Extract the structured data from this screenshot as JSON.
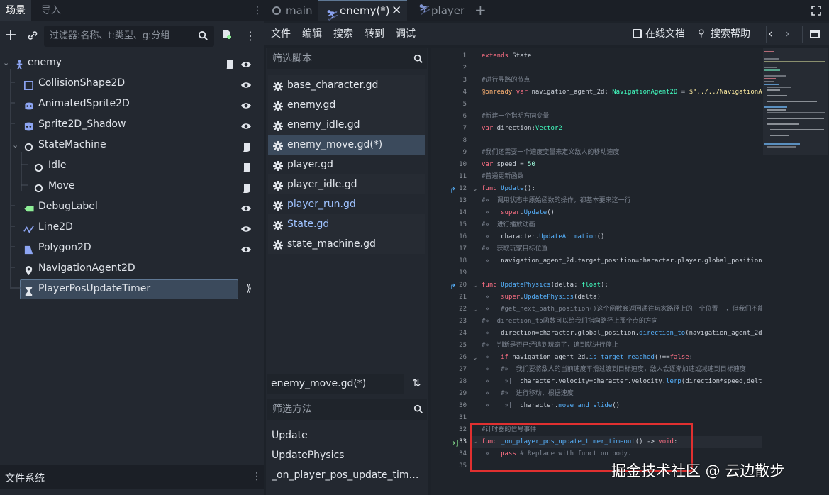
{
  "left_dock": {
    "tabs": [
      "场景",
      "导入"
    ],
    "filter_placeholder": "过滤器:名称、t:类型、g:分组",
    "filesystem_tab": "文件系统"
  },
  "scene_tree": [
    {
      "name": "enemy",
      "icon": "character-icon",
      "depth": 0,
      "script": true,
      "visible": true,
      "collapsible": true
    },
    {
      "name": "CollisionShape2D",
      "icon": "collision-shape-icon",
      "depth": 1,
      "visible": true
    },
    {
      "name": "AnimatedSprite2D",
      "icon": "animated-sprite-icon",
      "depth": 1,
      "visible": true
    },
    {
      "name": "Sprite2D_Shadow",
      "icon": "sprite-icon",
      "depth": 1,
      "visible": true
    },
    {
      "name": "StateMachine",
      "icon": "node-icon",
      "depth": 1,
      "script": true,
      "collapsible": true
    },
    {
      "name": "Idle",
      "icon": "node-icon",
      "depth": 2,
      "script": true
    },
    {
      "name": "Move",
      "icon": "node-icon",
      "depth": 2,
      "script": true
    },
    {
      "name": "DebugLabel",
      "icon": "label-icon",
      "depth": 1,
      "visible": true
    },
    {
      "name": "Line2D",
      "icon": "line-icon",
      "depth": 1,
      "visible": true
    },
    {
      "name": "Polygon2D",
      "icon": "polygon-icon",
      "depth": 1,
      "visible": true
    },
    {
      "name": "NavigationAgent2D",
      "icon": "navigation-agent-icon",
      "depth": 1
    },
    {
      "name": "PlayerPosUpdateTimer",
      "icon": "timer-icon",
      "depth": 1,
      "signal": true,
      "selected": true
    }
  ],
  "editor_tabs": [
    {
      "label": "main",
      "icon": "node-icon"
    },
    {
      "label": "enemy(*)",
      "icon": "character-icon",
      "active": true
    },
    {
      "label": "player",
      "icon": "character-icon"
    }
  ],
  "menu": [
    "文件",
    "编辑",
    "搜索",
    "转到",
    "调试"
  ],
  "menu_right": {
    "online_docs": "在线文档",
    "search_help": "搜索帮助"
  },
  "scripts": {
    "filter_placeholder": "筛选脚本",
    "items": [
      {
        "name": "base_character.gd"
      },
      {
        "name": "enemy.gd"
      },
      {
        "name": "enemy_idle.gd"
      },
      {
        "name": "enemy_move.gd(*)",
        "selected": true
      },
      {
        "name": "player.gd"
      },
      {
        "name": "player_idle.gd"
      },
      {
        "name": "player_run.gd",
        "highlight": true
      },
      {
        "name": "State.gd",
        "highlight": true
      },
      {
        "name": "state_machine.gd"
      }
    ],
    "current": "enemy_move.gd(*)",
    "method_filter_placeholder": "筛选方法",
    "methods": [
      "Update",
      "UpdatePhysics",
      "_on_player_pos_update_timer_timeout"
    ]
  },
  "code_lines": [
    {
      "n": "1",
      "html": "<span class='kw'>extends</span> State"
    },
    {
      "n": "2",
      "html": ""
    },
    {
      "n": "3",
      "html": "<span class='cm'>#进行寻路的节点</span>"
    },
    {
      "n": "4",
      "html": "<span class='an'>@onready</span> <span class='kw'>var</span> navigation_agent_2d: <span class='ty'>NavigationAgent2D</span> = <span class='st'>$\"../../NavigationA</span>"
    },
    {
      "n": "5",
      "html": ""
    },
    {
      "n": "6",
      "html": "<span class='cm'>#新建一个指明方向变量</span>"
    },
    {
      "n": "7",
      "html": "<span class='kw'>var</span> direction:<span class='ty'>Vector2</span>"
    },
    {
      "n": "8",
      "html": ""
    },
    {
      "n": "9",
      "html": "<span class='cm'>#我们还需要一个速度变量来定义敌人的移动速度</span>"
    },
    {
      "n": "10",
      "html": "<span class='kw'>var</span> speed = <span class='nb'>50</span>"
    },
    {
      "n": "11",
      "html": "<span class='cm'>#普通更新函数</span>"
    },
    {
      "n": "12",
      "html": "<span class='kw'>func</span> <span class='fn'>Update</span>():"
    },
    {
      "n": "13",
      "html": "<span class='cm'>#»  调用状态中原始函数的操作，都基本要来这一行</span>"
    },
    {
      "n": "14",
      "html": "<span class='cm'> »|</span>  <span class='kw'>super</span>.<span class='fn'>Update</span>()"
    },
    {
      "n": "15",
      "html": "<span class='cm'>#»  进行播放动画</span>"
    },
    {
      "n": "16",
      "html": "<span class='cm'> »|</span>  character.<span class='fn'>UpdateAnimation</span>()"
    },
    {
      "n": "17",
      "html": "<span class='cm'>#»  获取玩家目标位置</span>"
    },
    {
      "n": "18",
      "html": "<span class='cm'> »|</span>  navigation_agent_2d.target_position=character.player.global_position"
    },
    {
      "n": "19",
      "html": ""
    },
    {
      "n": "20",
      "html": "<span class='kw'>func</span> <span class='fn'>UpdatePhysics</span>(delta: <span class='ty'>float</span>):"
    },
    {
      "n": "21",
      "html": "<span class='cm'> »|</span>  <span class='kw'>super</span>.<span class='fn'>UpdatePhysics</span>(delta)"
    },
    {
      "n": "22",
      "html": "<span class='cm'> »|  #get_next_path_position()这个函数会返回通往玩家路径上的一个位置  ，但我们不能</span>"
    },
    {
      "n": "23",
      "html": "<span class='cm'>#»  direction_to函数可以给我们指向路径上那个点的方向</span>"
    },
    {
      "n": "24",
      "html": "<span class='cm'> »|</span>  direction=character.global_position.<span class='fn'>direction_to</span>(navigation_agent_2d."
    },
    {
      "n": "25",
      "html": "<span class='cm'>#»  判断是否已经追到玩家了，追到就进行停止</span>"
    },
    {
      "n": "26",
      "html": "<span class='cm'> »|</span>  <span class='kw'>if</span> navigation_agent_2d.<span class='fn'>is_target_reached</span>()==<span class='kw'>false</span>:"
    },
    {
      "n": "27",
      "html": "<span class='cm'> »|  #»  我们要将敌人的当前速度平滑过渡到目标速度，敌人会逐渐加速或减速到目标速度</span>"
    },
    {
      "n": "28",
      "html": "<span class='cm'> »|   »|</span>  character.velocity=character.velocity.<span class='fn'>lerp</span>(direction*speed,delta)"
    },
    {
      "n": "29",
      "html": "<span class='cm'> »|  #»  进行移动，根据速度</span>"
    },
    {
      "n": "30",
      "html": "<span class='cm'> »|   »|</span>  character.<span class='fn'>move_and_slide</span>()"
    },
    {
      "n": "31",
      "html": ""
    },
    {
      "n": "32",
      "html": "<span class='cm'>#计时器的信号事件</span>"
    },
    {
      "n": "33",
      "html": "<span class='kw'>func</span> <span class='fn'>_on_player_pos_update_timer_timeout</span>() -> <span class='kw'>void</span>:"
    },
    {
      "n": "34",
      "html": "<span class='cm'> »|</span>  <span class='kw'>pass</span> <span class='cm'># Replace with function body.</span>"
    },
    {
      "n": "35",
      "html": ""
    }
  ],
  "watermark": "掘金技术社区 @ 云边散步",
  "colors": {
    "accent": "#5f7894",
    "selection": "#3b4a5c",
    "highlight_box": "#e03030"
  }
}
